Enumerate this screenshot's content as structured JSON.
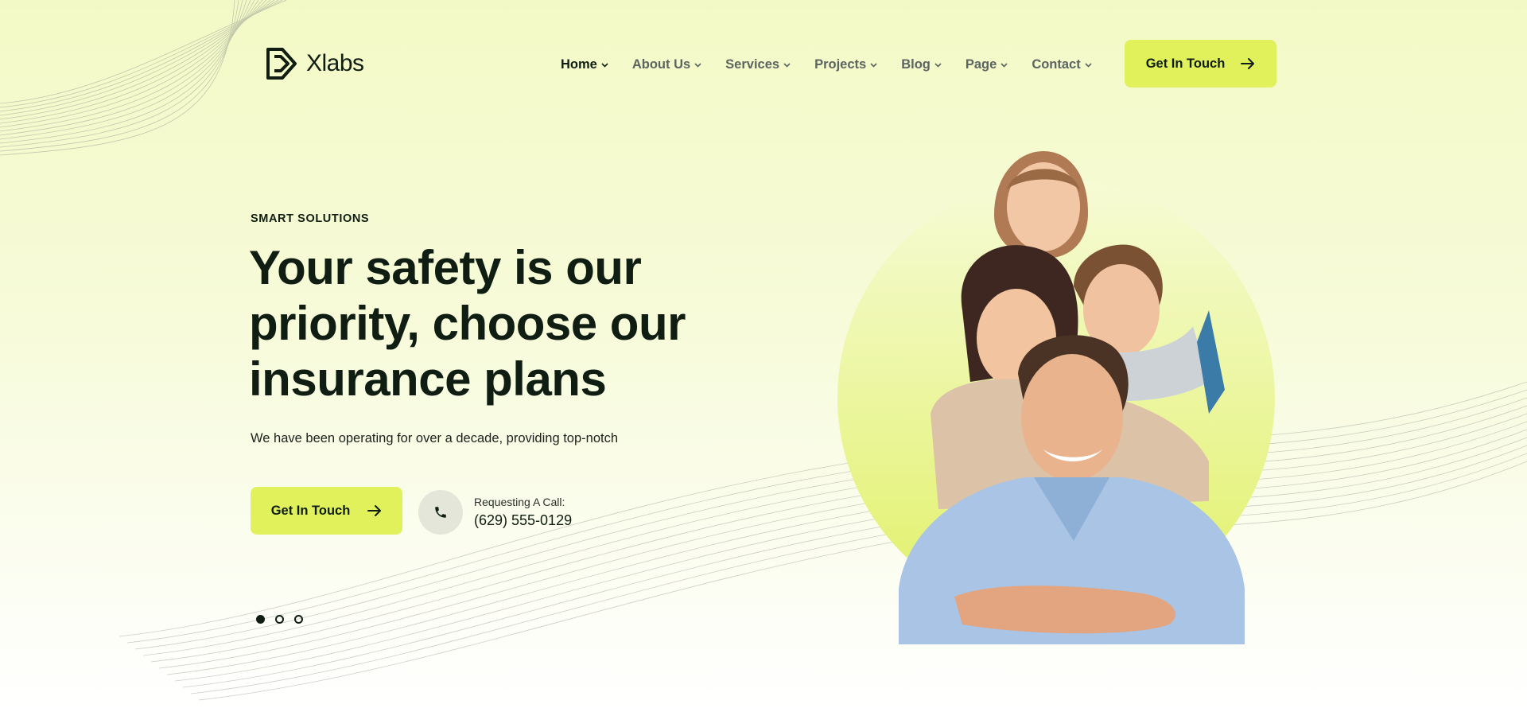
{
  "brand": {
    "name": "Xlabs"
  },
  "nav": {
    "items": [
      {
        "label": "Home"
      },
      {
        "label": "About Us"
      },
      {
        "label": "Services"
      },
      {
        "label": "Projects"
      },
      {
        "label": "Blog"
      },
      {
        "label": "Page"
      },
      {
        "label": "Contact"
      }
    ]
  },
  "header": {
    "cta_label": "Get In Touch"
  },
  "hero": {
    "eyebrow": "SMART SOLUTIONS",
    "headline": "Your safety is our priority, choose our insurance plans",
    "subtext": "We have been operating for over a decade, providing top-notch",
    "cta_label": "Get In Touch",
    "call_label": "Requesting A Call:",
    "call_phone": "(629) 555-0129",
    "slides": {
      "count": 3,
      "active": 1
    }
  },
  "colors": {
    "accent": "#e1f15b",
    "ink": "#0f1d12",
    "muted": "#5b6460",
    "background": "#f3f9c6"
  },
  "icons": [
    "logo-mark-icon",
    "chevron-down-icon",
    "arrow-right-icon",
    "phone-icon"
  ],
  "image": {
    "subject": "family-photo"
  }
}
